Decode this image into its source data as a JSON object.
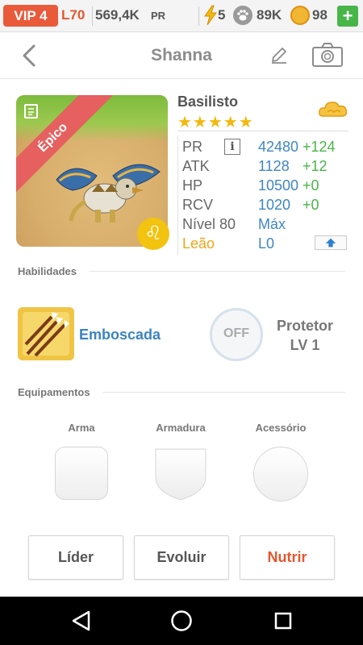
{
  "status_bar": {
    "vip": "VIP 4",
    "level": "L70",
    "power": "569,4K",
    "power_unit": "PR",
    "energy": "5",
    "paw": "89K",
    "coins": "98",
    "add": "+"
  },
  "header": {
    "title": "Shanna"
  },
  "pet": {
    "rarity": "Épico",
    "species": "Basilisto",
    "stars": "★★★★★",
    "zodiac_symbol": "♌",
    "stats": [
      {
        "label": "PR",
        "value": "42480",
        "bonus": "+124"
      },
      {
        "label": "ATK",
        "value": "1128",
        "bonus": "+12"
      },
      {
        "label": "HP",
        "value": "10500",
        "bonus": "+0"
      },
      {
        "label": "RCV",
        "value": "1020",
        "bonus": "+0"
      },
      {
        "label": "Nível 80",
        "value": "Máx"
      },
      {
        "label": "Leão",
        "value": "L0"
      }
    ],
    "info": "i"
  },
  "skills": {
    "title": "Habilidades",
    "active": "Emboscada",
    "passive_state": "OFF",
    "passive_name": "Protetor",
    "passive_level": "LV 1"
  },
  "equipment": {
    "title": "Equipamentos",
    "slots": [
      "Arma",
      "Armadura",
      "Acessório"
    ]
  },
  "actions": {
    "leader": "Líder",
    "evolve": "Evoluir",
    "feed": "Nutrir"
  },
  "colors": {
    "accent": "#3f86c4",
    "bonus": "#48b549",
    "rarity": "#e5605e",
    "nutrir": "#e8552e"
  }
}
